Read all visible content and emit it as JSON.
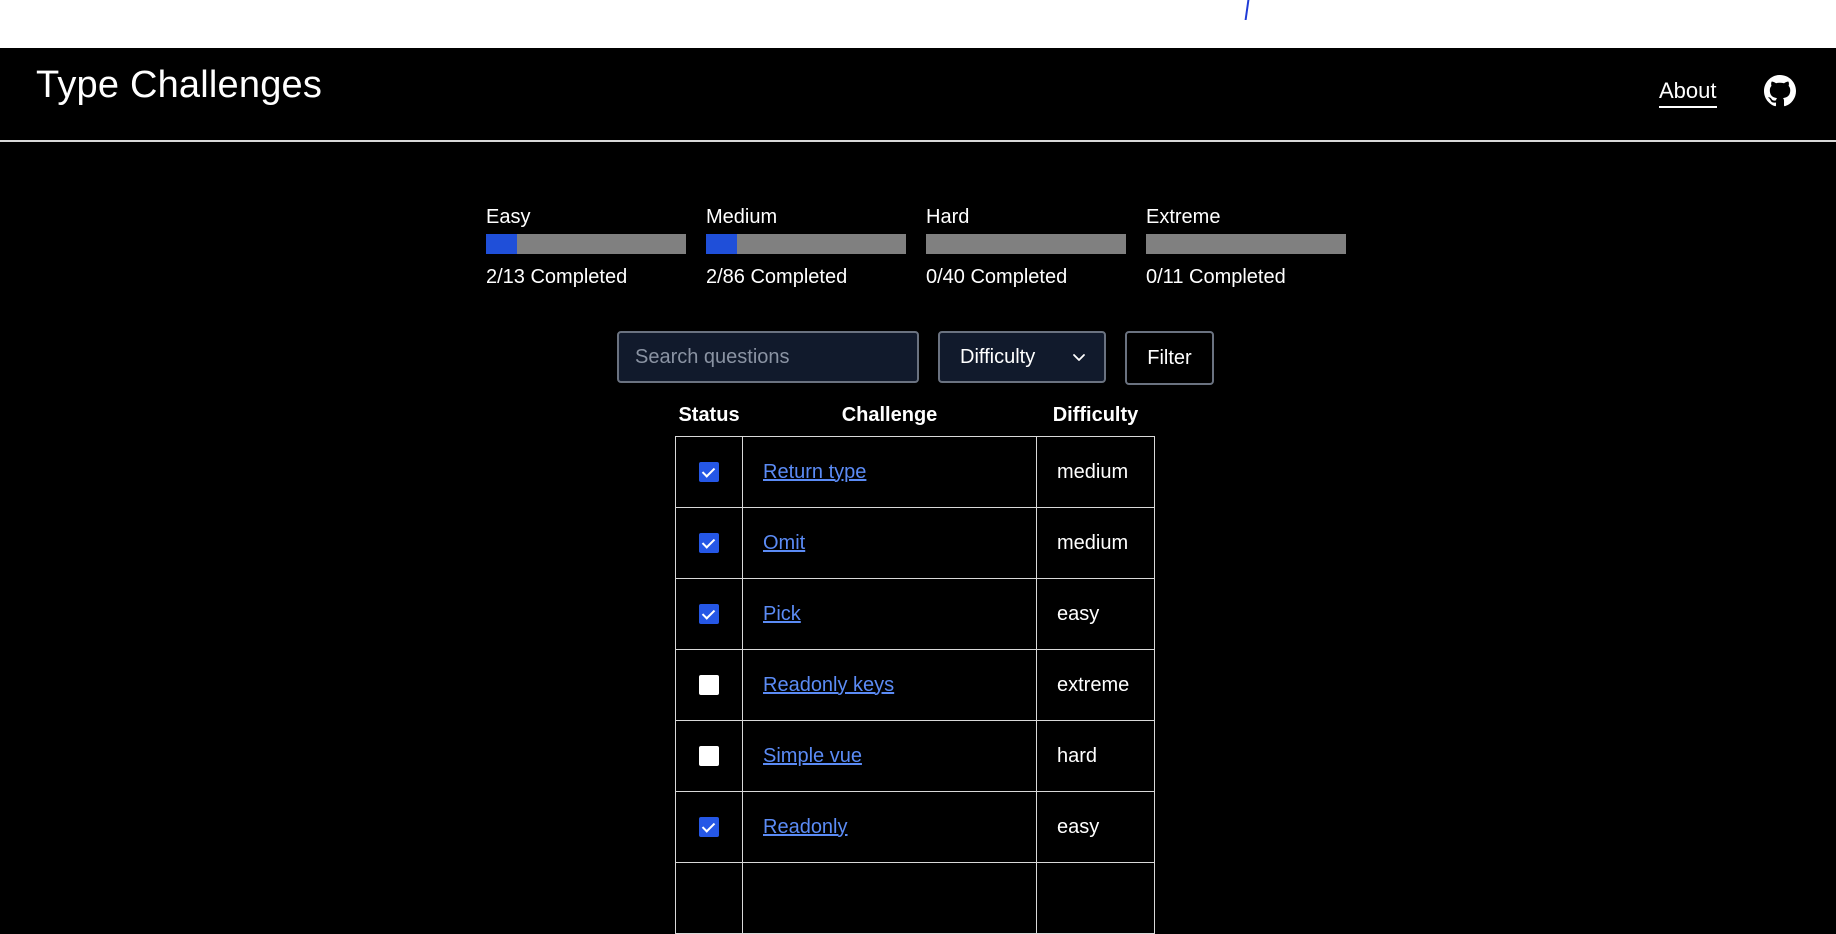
{
  "header": {
    "title": "Type Challenges",
    "about_label": "About",
    "github_icon": "github-icon"
  },
  "progress": [
    {
      "label": "Easy",
      "completed_text": "2/13 Completed",
      "fraction": 0.1538
    },
    {
      "label": "Medium",
      "completed_text": "2/86 Completed",
      "fraction": 0.1538
    },
    {
      "label": "Hard",
      "completed_text": "0/40 Completed",
      "fraction": 0
    },
    {
      "label": "Extreme",
      "completed_text": "0/11 Completed",
      "fraction": 0
    }
  ],
  "controls": {
    "search_placeholder": "Search questions",
    "difficulty_label": "Difficulty",
    "filter_label": "Filter"
  },
  "table": {
    "headers": {
      "status": "Status",
      "challenge": "Challenge",
      "difficulty": "Difficulty"
    },
    "rows": [
      {
        "done": true,
        "name": "Return type",
        "difficulty": "medium"
      },
      {
        "done": true,
        "name": "Omit",
        "difficulty": "medium"
      },
      {
        "done": true,
        "name": "Pick",
        "difficulty": "easy"
      },
      {
        "done": false,
        "name": "Readonly keys",
        "difficulty": "extreme"
      },
      {
        "done": false,
        "name": "Simple vue",
        "difficulty": "hard"
      },
      {
        "done": true,
        "name": "Readonly",
        "difficulty": "easy"
      },
      {
        "done": false,
        "name": "",
        "difficulty": ""
      }
    ]
  },
  "colors": {
    "accent": "#1f4fd9",
    "link": "#5b8bf5",
    "bar_track": "#808080",
    "background": "#000000"
  }
}
